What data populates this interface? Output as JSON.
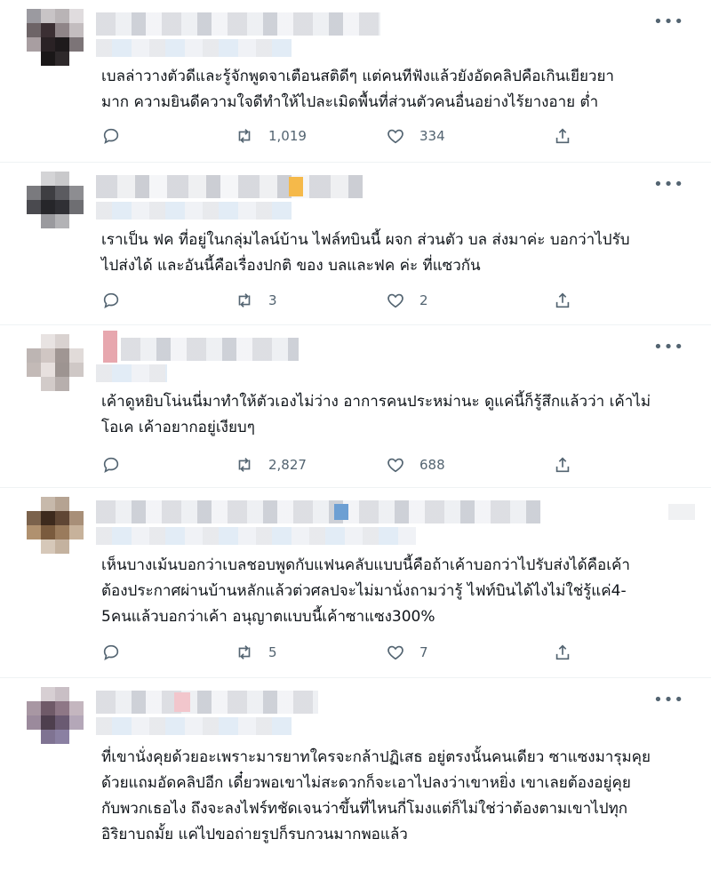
{
  "tweets": [
    {
      "text": "เบลล่าวางตัวดีและรู้จักพูดจาเตือนสติดีๆ แต่คนทีฟังแล้วยังอัดคลิปคือเกินเยียวยา\nมาก ความยินดีความใจดีทำให้ไปละเมิดพื้นที่ส่วนตัวคนอื่นอย่างไร้ยางอาย ต่ำ",
      "replies": "",
      "retweets": "1,019",
      "likes": "334"
    },
    {
      "text": "เราเป็น ฟค ที่อยู่ในกลุ่มไลน์บ้าน ไฟล์ทบินนี้ ผจก ส่วนตัว บล ส่งมาค่ะ บอกว่าไปรับ\nไปส่งได้ และอันนี้คือเรื่องปกติ ของ บลและฟค ค่ะ ที่แซวกัน",
      "replies": "",
      "retweets": "3",
      "likes": "2"
    },
    {
      "text": "เค้าดูหยิบโน่นนี่มาทำให้ตัวเองไม่ว่าง อาการคนประหม่านะ ดูแค่นี้ก็รู้สึกแล้วว่า เค้าไม่\nโอเค เค้าอยากอยู่เงียบๆ",
      "replies": "",
      "retweets": "2,827",
      "likes": "688"
    },
    {
      "text": "เห็นบางเม้นบอกว่าเบลชอบพูดกับแฟนคลับแบบนี้คือถ้าเค้าบอกว่าไปรับส่งได้คือเค้า\nต้องประกาศผ่านบ้านหลักแล้วต่วศลปจะไม่มานั่งถามว่ารู้ ไฟท์บินได้ไงไม่ใช่รู้แค่4-\n5คนแล้วบอกว่าเค้า อนุญาตแบบนี้เค้าซาแซง300%",
      "replies": "",
      "retweets": "5",
      "likes": "7"
    },
    {
      "text": "ที่เขานั่งคุยด้วยอะเพราะมารยาทใครจะกล้าปฏิเสธ อยู่ตรงนั้นคนเดียว ซาแซงมารุมคุย\nด้วยแถมอัดคลิปอีก เดี๋ยวพอเขาไม่สะดวกก็จะเอาไปลงว่าเขาหยิ่ง เขาเลยต้องอยู่คุย\nกับพวกเธอไง ถึงจะลงไฟร์ทชัดเจนว่าขึ้นที่ไหนกี่โมงแต่ก็ไม่ใช่ว่าต้องตามเขาไปทุก\nอิริยาบถมั้ย แค่ไปขอถ่ายรูปก็รบกวนมากพอแล้ว"
    }
  ],
  "more_label": "•••",
  "icons": [
    "reply-icon",
    "retweet-icon",
    "like-icon",
    "share-icon",
    "more-icon"
  ]
}
